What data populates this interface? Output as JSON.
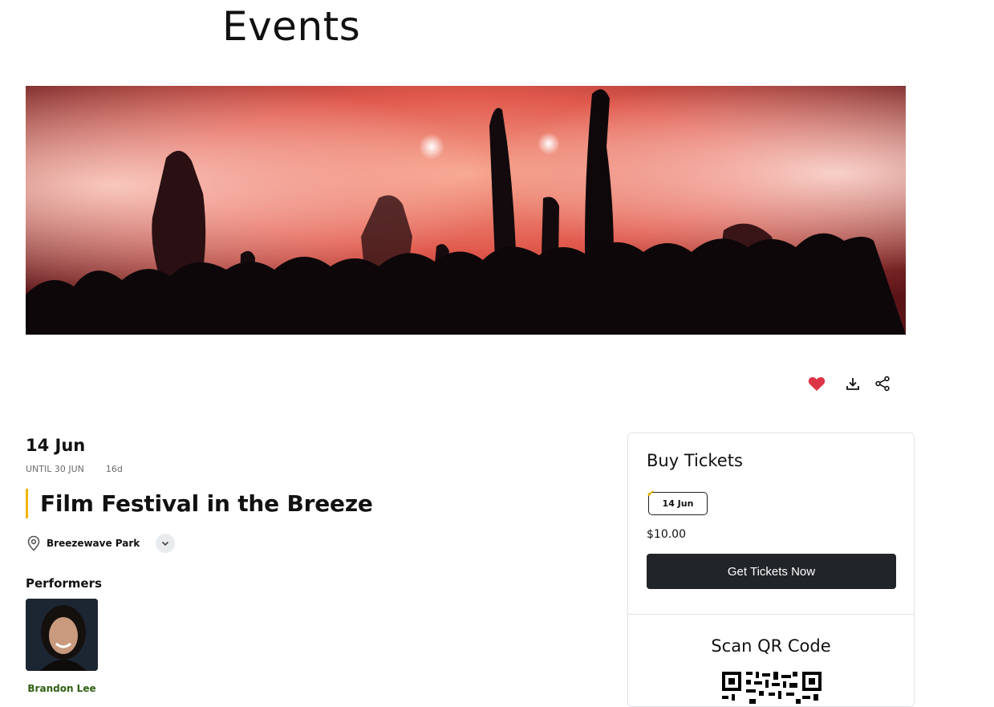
{
  "page": {
    "title": "Events"
  },
  "hero": {
    "alt_subject": "concert crowd"
  },
  "actions": {
    "favorite_icon": "heart-icon",
    "download_icon": "download-icon",
    "share_icon": "share-icon",
    "favorite_color": "#dc3545"
  },
  "event": {
    "date": "14 Jun",
    "until": "UNTIL 30 JUN",
    "days_left": "16d",
    "title": "Film Festival in the Breeze",
    "venue": "Breezewave Park",
    "accent_color": "#f4b400"
  },
  "performers": {
    "label": "Performers",
    "items": [
      {
        "name": "Brandon Lee"
      }
    ]
  },
  "tickets": {
    "heading": "Buy Tickets",
    "dates": [
      {
        "label": "14 Jun",
        "selected": true
      }
    ],
    "price": "$10.00",
    "button_label": "Get Tickets Now"
  },
  "qr": {
    "heading": "Scan QR Code"
  }
}
